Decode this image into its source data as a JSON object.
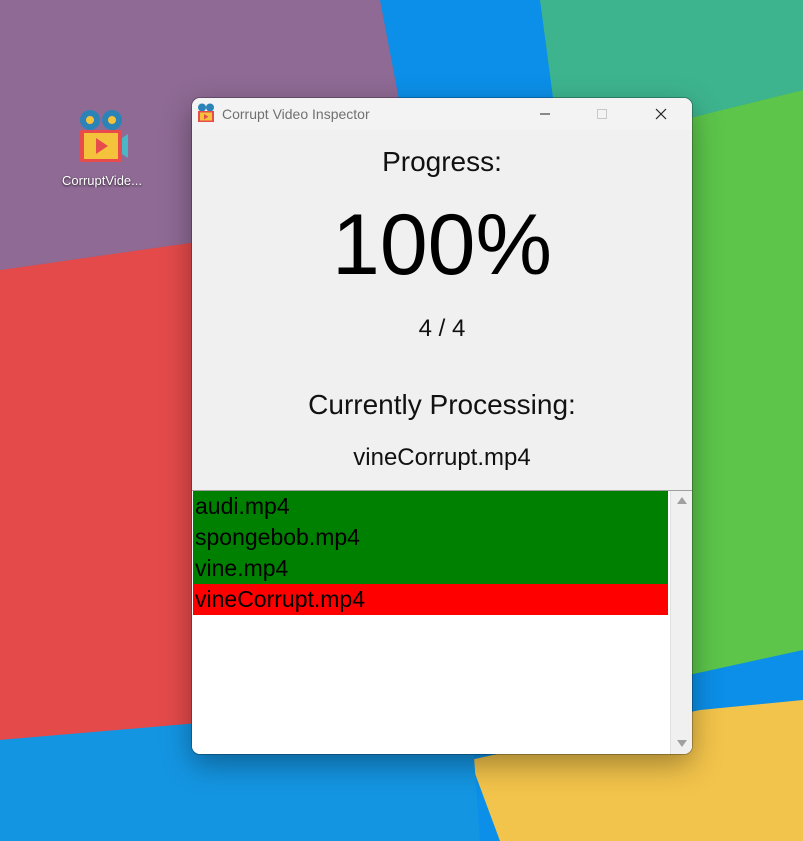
{
  "desktop": {
    "icon_label": "CorruptVide..."
  },
  "window": {
    "title": "Corrupt Video Inspector",
    "progress_label": "Progress:",
    "percent": "100%",
    "count": "4 / 4",
    "processing_label": "Currently Processing:",
    "current_file": "vineCorrupt.mp4"
  },
  "file_list": [
    {
      "name": "audi.mp4",
      "status": "ok",
      "color": "#008000"
    },
    {
      "name": "spongebob.mp4",
      "status": "ok",
      "color": "#008000"
    },
    {
      "name": "vine.mp4",
      "status": "ok",
      "color": "#008000"
    },
    {
      "name": "vineCorrupt.mp4",
      "status": "corrupt",
      "color": "#ff0000"
    }
  ]
}
